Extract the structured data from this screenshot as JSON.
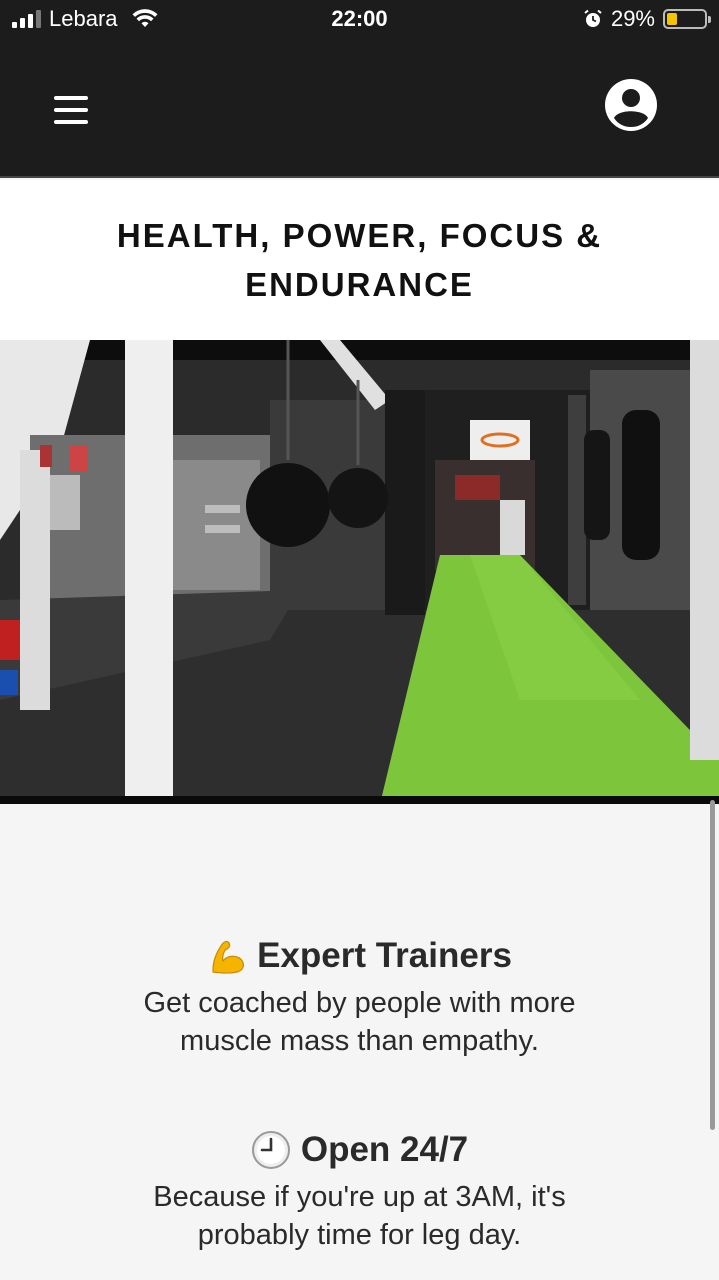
{
  "status_bar": {
    "carrier": "Lebara",
    "time": "22:00",
    "battery_percent_text": "29%",
    "battery_level": 0.29,
    "icons": [
      "signal-icon",
      "wifi-icon",
      "alarm-icon",
      "battery-icon"
    ]
  },
  "header": {
    "menu_icon": "hamburger-menu-icon",
    "profile_icon": "account-circle-icon",
    "background": "#1c1c1c"
  },
  "hero": {
    "title_line1": "HEALTH, POWER, FOCUS &",
    "title_line2": "ENDURANCE",
    "photo_subject": "boxing-gym-interior-photo"
  },
  "features": [
    {
      "icon": "flexed-biceps-icon",
      "title": "Expert Trainers",
      "description_line1": "Get coached by people with more",
      "description_line2": "muscle mass than empathy."
    },
    {
      "icon": "clock-icon",
      "title": "Open 24/7",
      "description_line1": "Because if you're up at 3AM, it's",
      "description_line2": "probably time for leg day."
    }
  ],
  "colors": {
    "header_bg": "#1c1c1c",
    "page_bg": "#f5f5f5",
    "turf_green": "#7dc63b",
    "battery_yellow": "#f5c400"
  }
}
